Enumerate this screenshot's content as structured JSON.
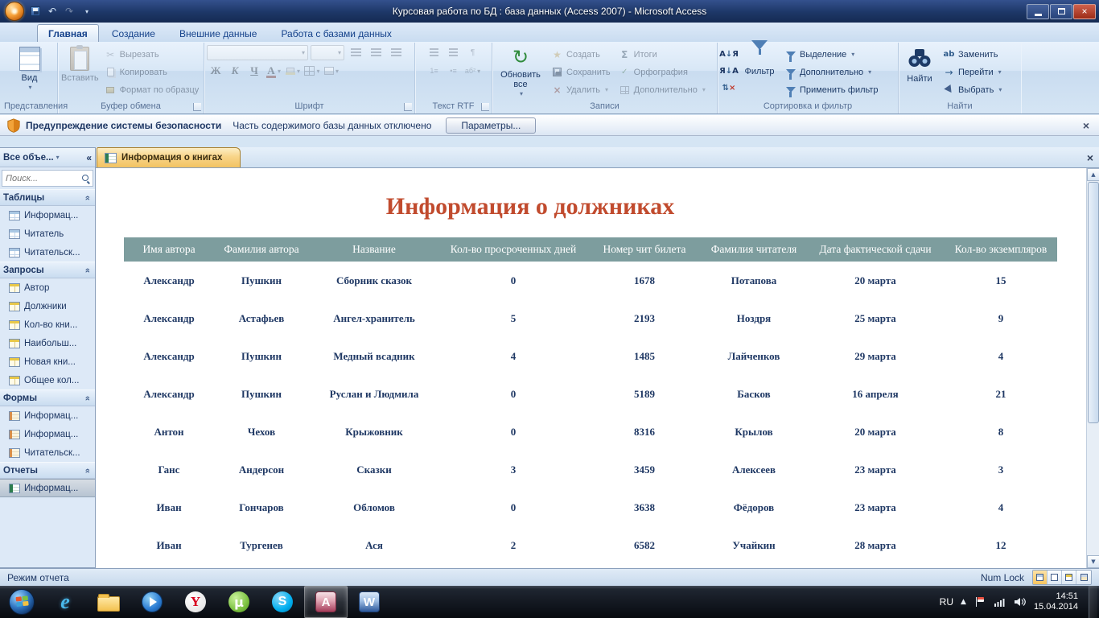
{
  "titlebar": {
    "title": "Курсовая работа по БД : база данных (Access 2007)  - Microsoft Access"
  },
  "ribbon": {
    "tabs": [
      "Главная",
      "Создание",
      "Внешние данные",
      "Работа с базами данных"
    ],
    "groups": {
      "views": {
        "label": "Представления",
        "view": "Вид"
      },
      "clipboard": {
        "label": "Буфер обмена",
        "paste": "Вставить",
        "cut": "Вырезать",
        "copy": "Копировать",
        "painter": "Формат по образцу"
      },
      "font": {
        "label": "Шрифт",
        "bold": "Ж",
        "italic": "К",
        "underline": "Ч",
        "color": "А"
      },
      "rtf": {
        "label": "Текст RTF"
      },
      "records": {
        "label": "Записи",
        "refresh": "Обновить все",
        "create": "Создать",
        "save": "Сохранить",
        "delete": "Удалить",
        "totals": "Итоги",
        "spelling": "Орфография",
        "more": "Дополнительно"
      },
      "sortfilter": {
        "label": "Сортировка и фильтр",
        "filter": "Фильтр",
        "selection": "Выделение",
        "advanced": "Дополнительно",
        "apply": "Применить фильтр"
      },
      "find": {
        "label": "Найти",
        "find": "Найти",
        "replace": "Заменить",
        "goto": "Перейти",
        "select": "Выбрать"
      }
    }
  },
  "security_bar": {
    "title": "Предупреждение системы безопасности",
    "message": "Часть содержимого базы данных отключено",
    "options_button": "Параметры..."
  },
  "nav": {
    "header": "Все объе...",
    "search_placeholder": "Поиск...",
    "sections": [
      {
        "title": "Таблицы",
        "items": [
          "Информац...",
          "Читатель",
          "Читательск..."
        ]
      },
      {
        "title": "Запросы",
        "items": [
          "Автор",
          "Должники",
          "Кол-во кни...",
          "Наибольш...",
          "Новая кни...",
          "Общее кол..."
        ]
      },
      {
        "title": "Формы",
        "items": [
          "Информац...",
          "Информац...",
          "Читательск..."
        ]
      },
      {
        "title": "Отчеты",
        "items": [
          "Информац..."
        ]
      }
    ]
  },
  "document": {
    "tab": "Информация о книгах",
    "title": "Информация о должниках",
    "headers": [
      "Имя автора",
      "Фамилия автора",
      "Название",
      "Кол-во просроченных дней",
      "Номер чит билета",
      "Фамилия читателя",
      "Дата фактической сдачи",
      "Кол-во экземпляров"
    ],
    "rows": [
      [
        "Александр",
        "Пушкин",
        "Сборник сказок",
        "0",
        "1678",
        "Потапова",
        "20 марта",
        "15"
      ],
      [
        "Александр",
        "Астафьев",
        "Ангел-хранитель",
        "5",
        "2193",
        "Ноздря",
        "25 марта",
        "9"
      ],
      [
        "Александр",
        "Пушкин",
        "Медный всадник",
        "4",
        "1485",
        "Лайченков",
        "29 марта",
        "4"
      ],
      [
        "Александр",
        "Пушкин",
        "Руслан и Людмила",
        "0",
        "5189",
        "Басков",
        "16 апреля",
        "21"
      ],
      [
        "Антон",
        "Чехов",
        "Крыжовник",
        "0",
        "8316",
        "Крылов",
        "20 марта",
        "8"
      ],
      [
        "Ганс",
        "Андерсон",
        "Сказки",
        "3",
        "3459",
        "Алексеев",
        "23 марта",
        "3"
      ],
      [
        "Иван",
        "Гончаров",
        "Обломов",
        "0",
        "3638",
        "Фёдоров",
        "23 марта",
        "4"
      ],
      [
        "Иван",
        "Тургенев",
        "Ася",
        "2",
        "6582",
        "Учайкин",
        "28 марта",
        "12"
      ]
    ]
  },
  "status": {
    "mode": "Режим отчета",
    "numlock": "Num Lock"
  },
  "taskbar": {
    "items": [
      "start",
      "internet-explorer",
      "windows-explorer",
      "media-player",
      "yandex-browser",
      "utorrent",
      "skype",
      "access",
      "word"
    ],
    "tray": {
      "lang": "RU",
      "time": "14:51",
      "date": "15.04.2014"
    }
  },
  "colors": {
    "table_header": "#7d9d9e",
    "report_title": "#c14b2e",
    "cell_text": "#1f3864",
    "doc_tab": "#f2c362"
  }
}
